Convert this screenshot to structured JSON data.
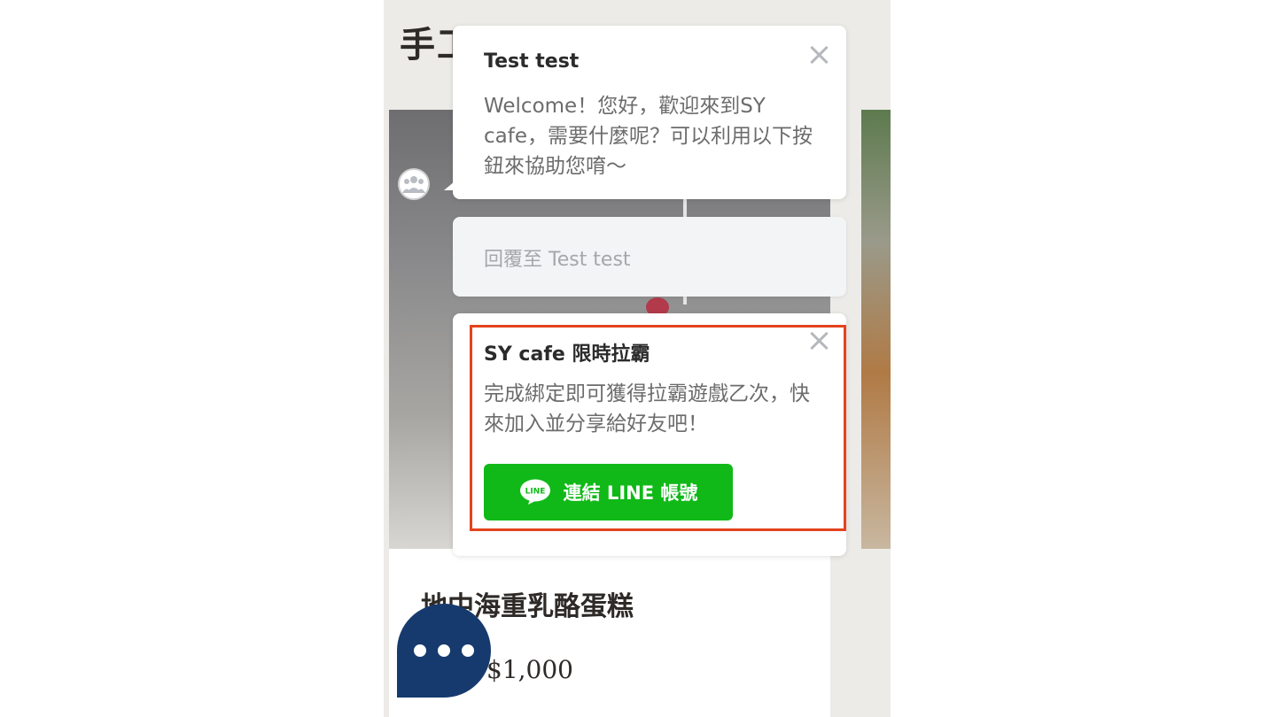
{
  "page": {
    "heading": "手工蛋糕"
  },
  "product": {
    "name": "地中海重乳酪蛋糕",
    "price": "$1,000"
  },
  "chat": {
    "message": {
      "sender": "Test test",
      "text": "Welcome！您好，歡迎來到SY cafe，需要什麼呢？可以利用以下按鈕來協助您唷～"
    },
    "reply": {
      "placeholder": "回覆至 Test test"
    },
    "promo": {
      "title": "SY cafe 限時拉霸",
      "text": "完成綁定即可獲得拉霸遊戲乙次，快來加入並分享給好友吧！",
      "button_label": "連結 LINE 帳號",
      "logo_text": "LINE"
    }
  },
  "colors": {
    "line_green": "#10b918",
    "highlight": "#e4431e",
    "fab": "#163a6e"
  },
  "icons": {
    "avatar": "group-avatar-icon",
    "close": "close-icon",
    "line": "line-logo-icon",
    "fab": "more-dots-icon"
  }
}
